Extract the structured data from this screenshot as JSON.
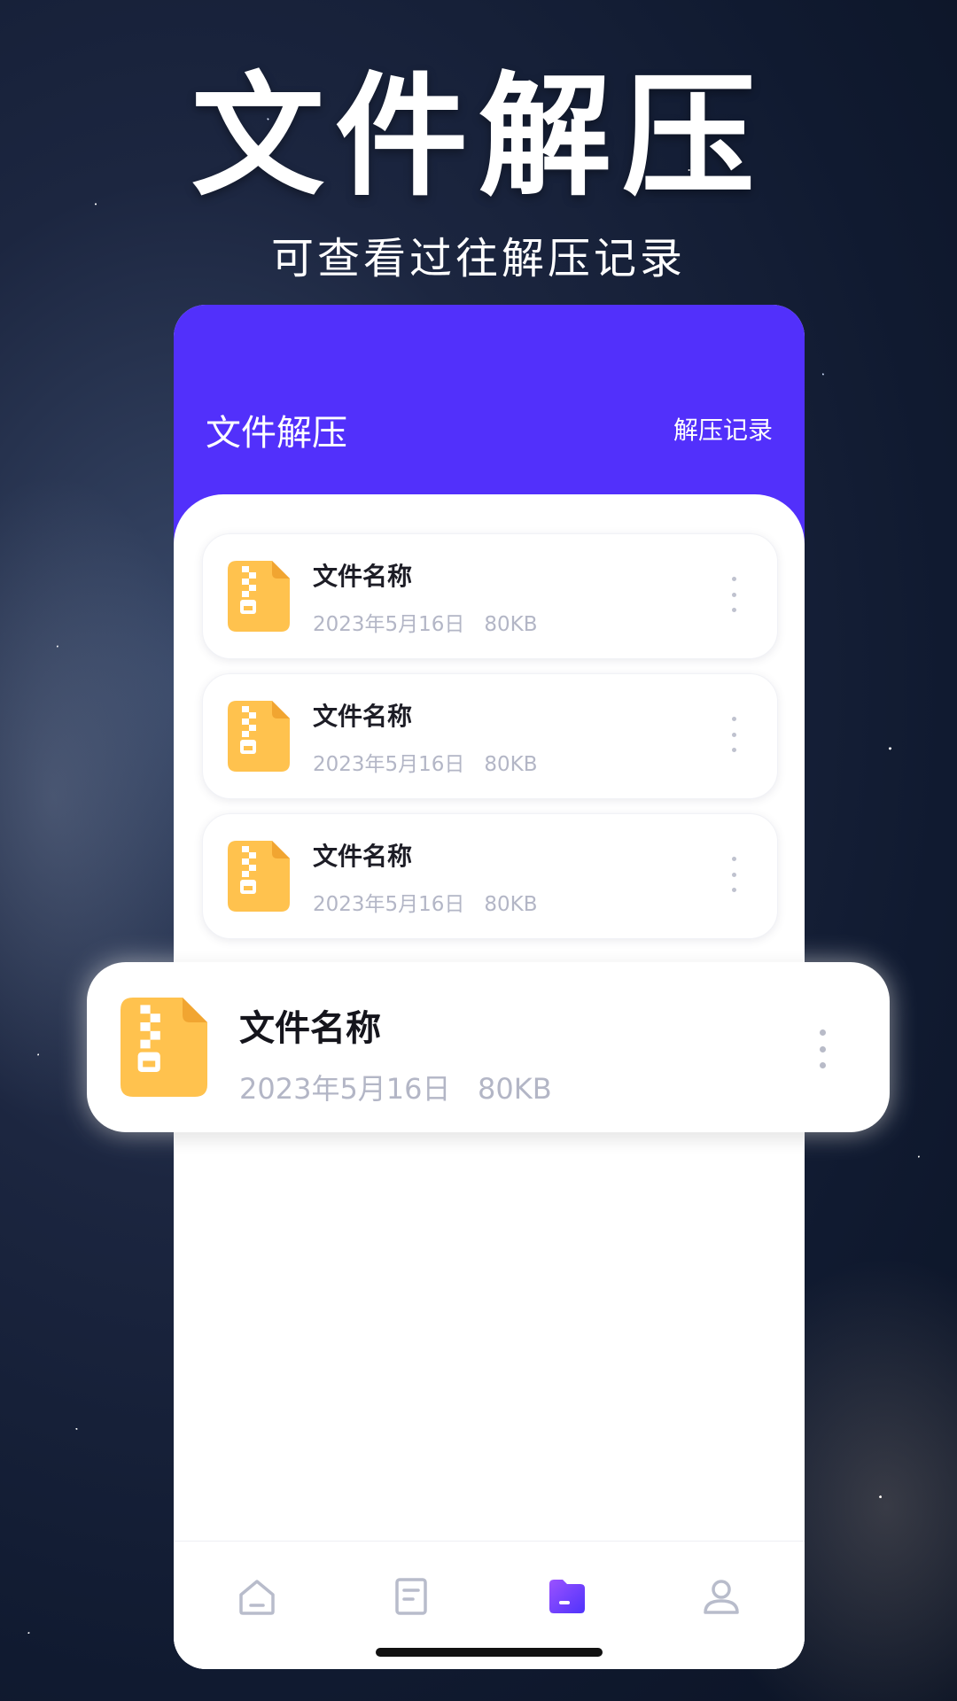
{
  "promo": {
    "title": "文件解压",
    "subtitle": "可查看过往解压记录"
  },
  "header": {
    "title": "文件解压",
    "records_link": "解压记录"
  },
  "files": [
    {
      "name": "文件名称",
      "date": "2023年5月16日",
      "size": "80KB"
    },
    {
      "name": "文件名称",
      "date": "2023年5月16日",
      "size": "80KB"
    },
    {
      "name": "文件名称",
      "date": "2023年5月16日",
      "size": "80KB"
    }
  ],
  "featured_file": {
    "name": "文件名称",
    "date": "2023年5月16日",
    "size": "80KB"
  },
  "bottom_nav": {
    "items": [
      {
        "icon": "home-icon",
        "active": false
      },
      {
        "icon": "document-icon",
        "active": false
      },
      {
        "icon": "folder-icon",
        "active": true
      },
      {
        "icon": "profile-icon",
        "active": false
      }
    ]
  },
  "colors": {
    "accent": "#5230fb",
    "zip_icon": "#ffc24e",
    "zip_fold": "#f1a531",
    "meta_text": "#b3b6c6",
    "nav_inactive": "#b8bccb"
  }
}
